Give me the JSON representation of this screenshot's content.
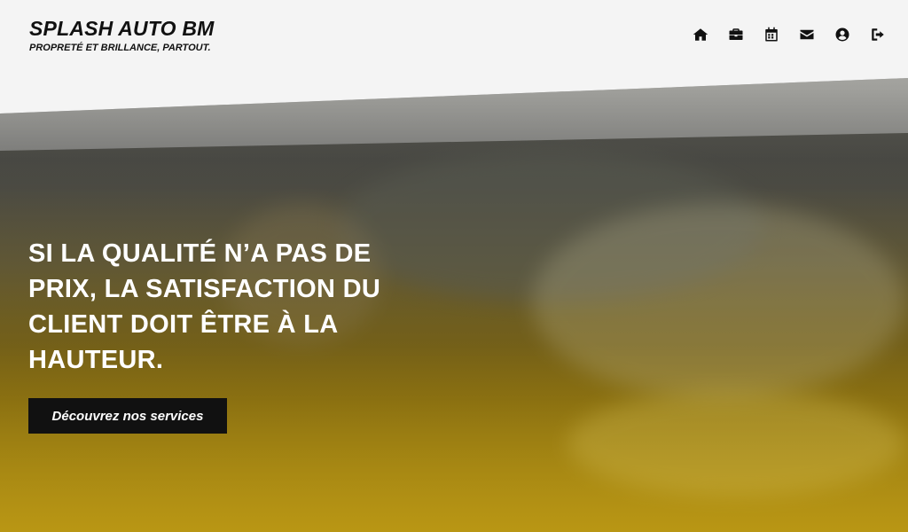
{
  "brand": {
    "title": "SPLASH AUTO BM",
    "tagline": "PROPRETÉ ET BRILLANCE, PARTOUT."
  },
  "nav": {
    "items": [
      {
        "icon": "home-icon"
      },
      {
        "icon": "briefcase-icon"
      },
      {
        "icon": "calendar-icon"
      },
      {
        "icon": "envelope-icon"
      },
      {
        "icon": "user-circle-icon"
      },
      {
        "icon": "sign-out-icon"
      }
    ]
  },
  "hero": {
    "headline": "SI LA QUALITÉ N’A PAS DE PRIX, LA SATISFACTION DU CLIENT DOIT ÊTRE À LA HAUTEUR.",
    "cta_label": "Découvrez nos services"
  },
  "colors": {
    "header_bg": "#f4f4f4",
    "accent_yellow": "#b79a1a",
    "button_bg": "#111111",
    "text_dark": "#111111"
  }
}
